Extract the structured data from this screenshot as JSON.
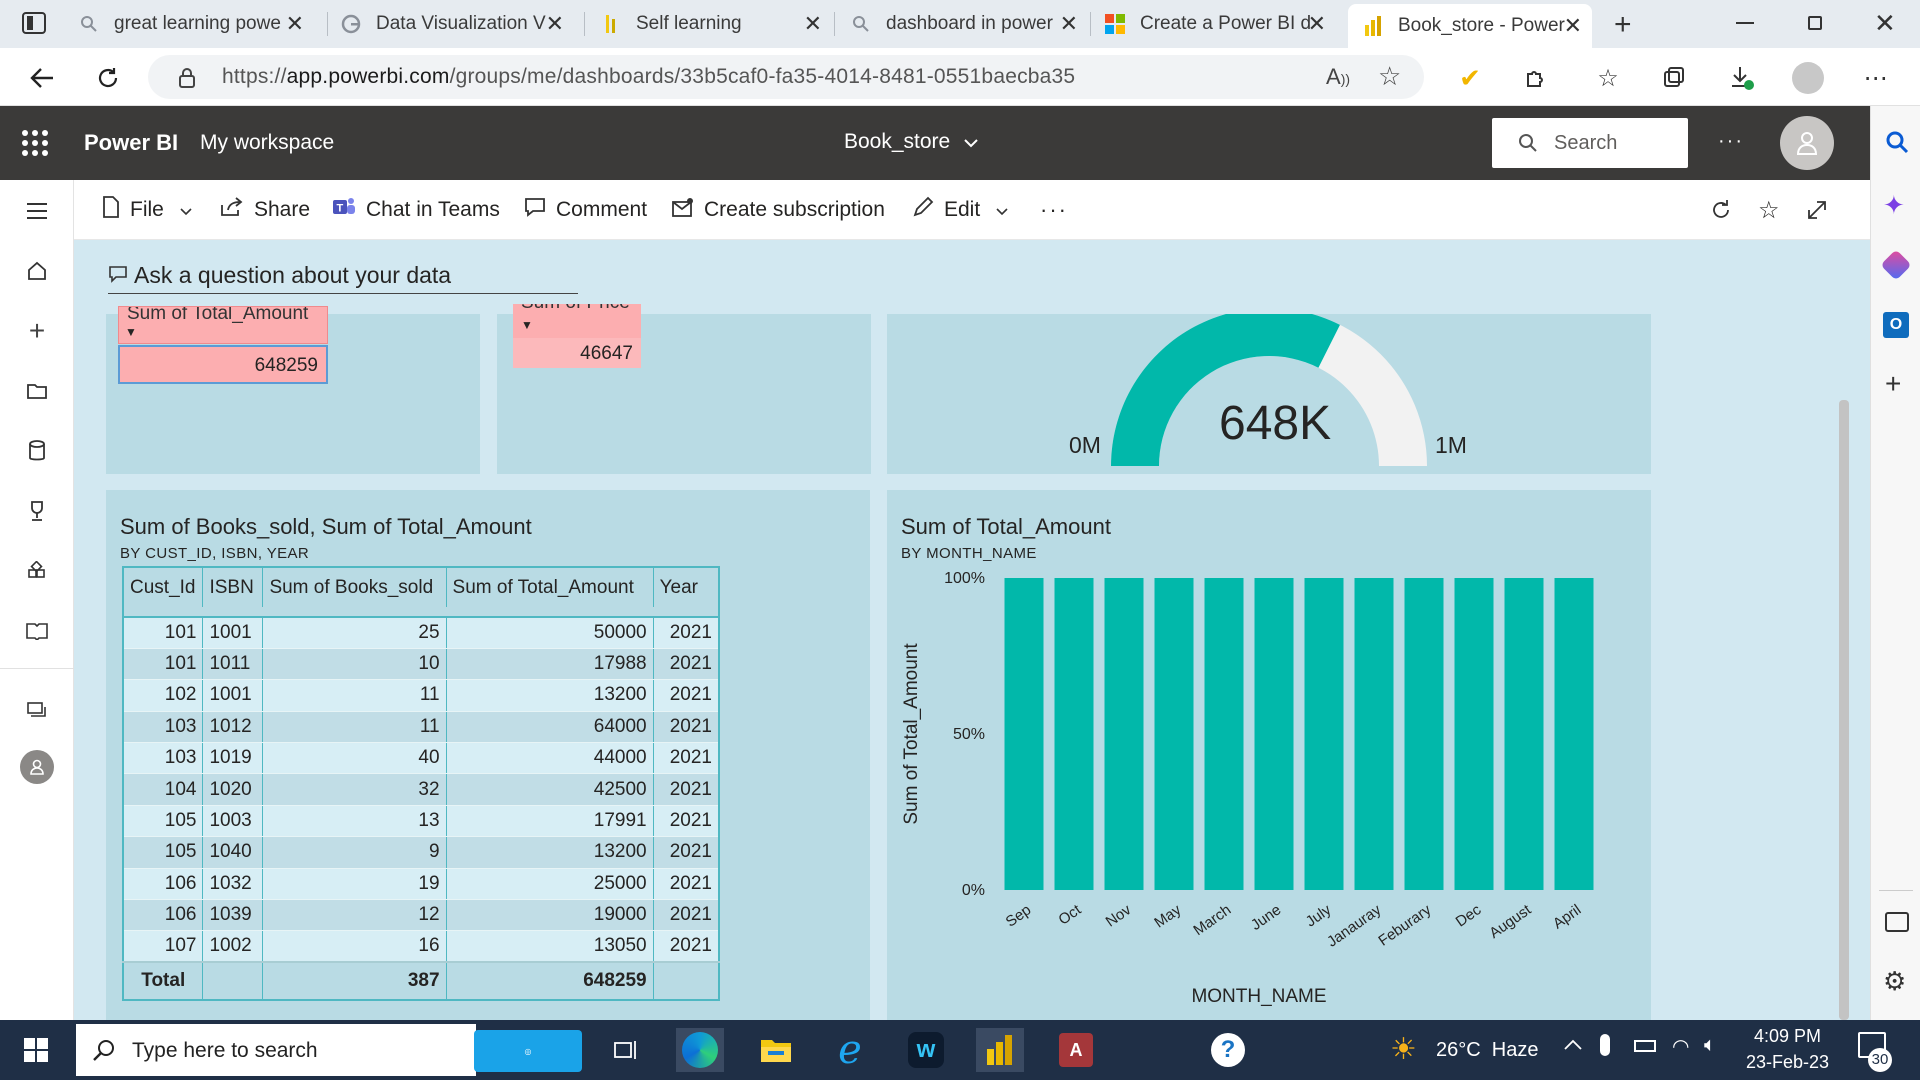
{
  "browser": {
    "tabs": [
      {
        "title": "great learning powe",
        "icon": "search-icon"
      },
      {
        "title": "Data Visualization V",
        "icon": "google-icon"
      },
      {
        "title": "Self learning",
        "icon": "bookmark-icon"
      },
      {
        "title": "dashboard in power",
        "icon": "search-icon"
      },
      {
        "title": "Create a Power BI d",
        "icon": "microsoft-icon"
      },
      {
        "title": "Book_store - Power",
        "icon": "powerbi-icon"
      }
    ],
    "url_prefix": "https://",
    "url_host": "app.powerbi.com",
    "url_path": "/groups/me/dashboards/33b5caf0-fa35-4014-8481-0551baecba35"
  },
  "header": {
    "app_name": "Power BI",
    "workspace": "My workspace",
    "dashboard_title": "Book_store",
    "search_placeholder": "Search",
    "more": "···"
  },
  "commands": {
    "file": "File",
    "share": "Share",
    "chat": "Chat in Teams",
    "comment": "Comment",
    "subscription": "Create subscription",
    "edit": "Edit",
    "more": "···"
  },
  "qna": {
    "label": "Ask a question about your data"
  },
  "tiles": {
    "card1": {
      "header": "Sum of Total_Amount",
      "value": "648259"
    },
    "card2": {
      "header": "Sum of Price",
      "value": "46647"
    },
    "gauge": {
      "value_label": "648K",
      "min_label": "0M",
      "max_label": "1M",
      "value": 648259,
      "min": 0,
      "max": 1000000,
      "fill_color": "#01b8aa",
      "track_color": "#f2f2f2"
    },
    "table": {
      "title": "Sum of Books_sold, Sum of Total_Amount",
      "subtitle": "BY CUST_ID, ISBN, YEAR",
      "columns": [
        "Cust_Id",
        "ISBN",
        "Sum of Books_sold",
        "Sum of Total_Amount",
        "Year"
      ],
      "rows": [
        [
          "101",
          "1001",
          "25",
          "50000",
          "2021"
        ],
        [
          "101",
          "1011",
          "10",
          "17988",
          "2021"
        ],
        [
          "102",
          "1001",
          "11",
          "13200",
          "2021"
        ],
        [
          "103",
          "1012",
          "11",
          "64000",
          "2021"
        ],
        [
          "103",
          "1019",
          "40",
          "44000",
          "2021"
        ],
        [
          "104",
          "1020",
          "32",
          "42500",
          "2021"
        ],
        [
          "105",
          "1003",
          "13",
          "17991",
          "2021"
        ],
        [
          "105",
          "1040",
          "9",
          "13200",
          "2021"
        ],
        [
          "106",
          "1032",
          "19",
          "25000",
          "2021"
        ],
        [
          "106",
          "1039",
          "12",
          "19000",
          "2021"
        ],
        [
          "107",
          "1002",
          "16",
          "13050",
          "2021"
        ]
      ],
      "total": {
        "label": "Total",
        "books": "387",
        "amount": "648259"
      }
    },
    "bar": {
      "title": "Sum of Total_Amount",
      "subtitle": "BY MONTH_NAME"
    }
  },
  "chart_data": {
    "type": "bar",
    "title": "Sum of Total_Amount",
    "subtitle": "BY MONTH_NAME",
    "xlabel": "MONTH_NAME",
    "ylabel": "Sum of Total_Amount",
    "categories": [
      "Sep",
      "Oct",
      "Nov",
      "May",
      "March",
      "June",
      "July",
      "Janauray",
      "Feburary",
      "Dec",
      "August",
      "April"
    ],
    "values": [
      100,
      100,
      100,
      100,
      100,
      100,
      100,
      100,
      100,
      100,
      100,
      100
    ],
    "yticks": [
      "0%",
      "50%",
      "100%"
    ],
    "ylim": [
      0,
      100
    ],
    "color": "#01b8aa"
  },
  "taskbar": {
    "search_placeholder": "Type here to search",
    "weather": "26°C  Haze",
    "time": "4:09 PM",
    "date": "23-Feb-23",
    "notifications": "30"
  }
}
